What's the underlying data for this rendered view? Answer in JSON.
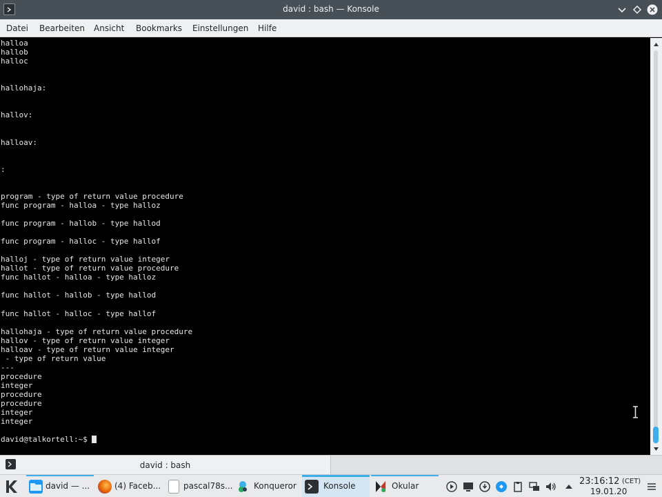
{
  "window": {
    "title": "david : bash — Konsole"
  },
  "menubar": [
    "Datei",
    "Bearbeiten",
    "Ansicht",
    "Bookmarks",
    "Einstellungen",
    "Hilfe"
  ],
  "terminal": {
    "lines": [
      "halloa",
      "hallob",
      "halloc",
      "",
      "",
      "hallohaja:",
      "",
      "",
      "hallov:",
      "",
      "",
      "halloav:",
      "",
      "",
      ":",
      "",
      "",
      "program - type of return value procedure",
      "func program - halloa - type halloz",
      "",
      "func program - hallob - type hallod",
      "",
      "func program - halloc - type hallof",
      "",
      "halloj - type of return value integer",
      "hallot - type of return value procedure",
      "func hallot - halloa - type halloz",
      "",
      "func hallot - hallob - type hallod",
      "",
      "func hallot - halloc - type hallof",
      "",
      "hallohaja - type of return value procedure",
      "hallov - type of return value integer",
      "halloav - type of return value integer",
      " - type of return value",
      "---",
      "procedure",
      "integer",
      "procedure",
      "procedure",
      "integer",
      "integer",
      "",
      "david@talkortell:~$ "
    ]
  },
  "tabs": [
    {
      "label": "david : bash"
    }
  ],
  "taskbar": {
    "tasks": [
      {
        "label": "david — ...",
        "icon": "folder-icon",
        "color": "#1d99f3"
      },
      {
        "label": "(4) Faceb...",
        "icon": "firefox-icon",
        "color": "#e66000"
      },
      {
        "label": "pascal78s...",
        "icon": "document-icon",
        "color": "#ffffff"
      },
      {
        "label": "Konqueror",
        "icon": "konqueror-icon",
        "color": "#3daee9"
      },
      {
        "label": "Konsole",
        "icon": "terminal-icon",
        "color": "#2b3034"
      },
      {
        "label": "Okular",
        "icon": "okular-icon",
        "color": "#232627"
      }
    ],
    "clock": {
      "time": "23:16:12",
      "timezone": "(CET)",
      "date": "19.01.20"
    }
  }
}
